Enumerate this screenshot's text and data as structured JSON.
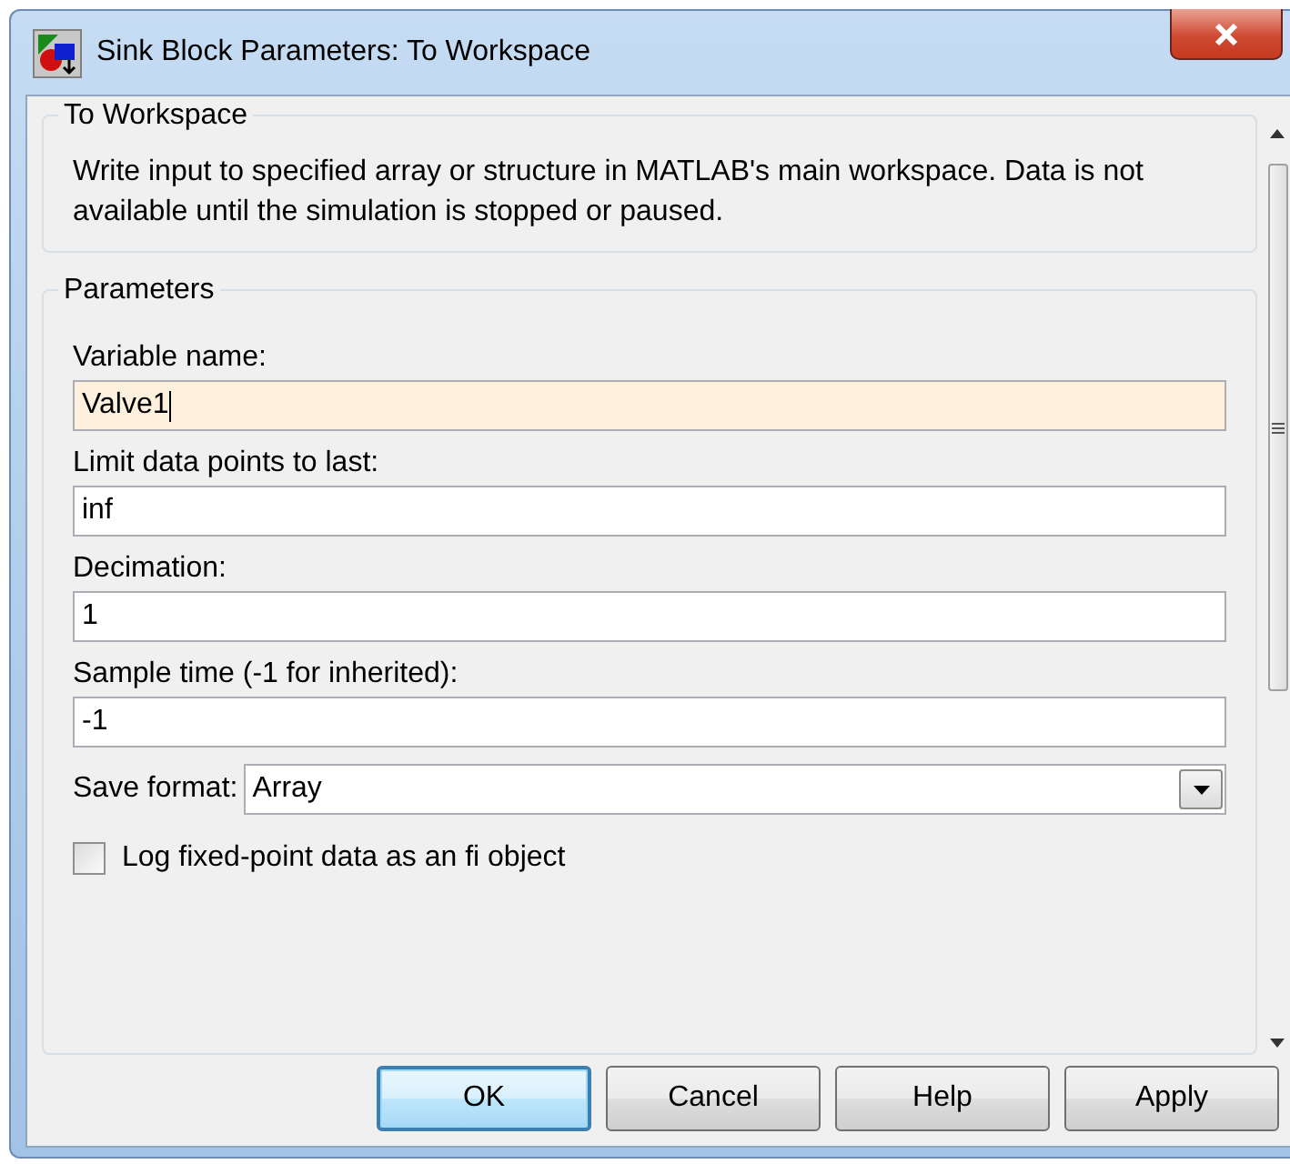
{
  "window": {
    "title": "Sink Block Parameters: To Workspace"
  },
  "description_group": {
    "title": "To Workspace",
    "text": "Write input to specified array or structure in MATLAB's main workspace. Data is not available until the simulation is stopped or paused."
  },
  "parameters": {
    "title": "Parameters",
    "fields": [
      {
        "kind": "text",
        "label": "Variable name:",
        "value": "Valve1",
        "focused": true
      },
      {
        "kind": "text",
        "label": "Limit data points to last:",
        "value": "inf",
        "focused": false
      },
      {
        "kind": "text",
        "label": "Decimation:",
        "value": "1",
        "focused": false
      },
      {
        "kind": "text",
        "label": "Sample time (-1 for inherited):",
        "value": "-1",
        "focused": false
      },
      {
        "kind": "dropdown",
        "label": "Save format:",
        "value": "Array"
      },
      {
        "kind": "checkbox",
        "label": "Log fixed-point data as an fi object",
        "checked": false
      }
    ]
  },
  "buttons": [
    {
      "label": "OK",
      "default": true
    },
    {
      "label": "Cancel",
      "default": false
    },
    {
      "label": "Help",
      "default": false
    },
    {
      "label": "Apply",
      "default": false
    }
  ]
}
